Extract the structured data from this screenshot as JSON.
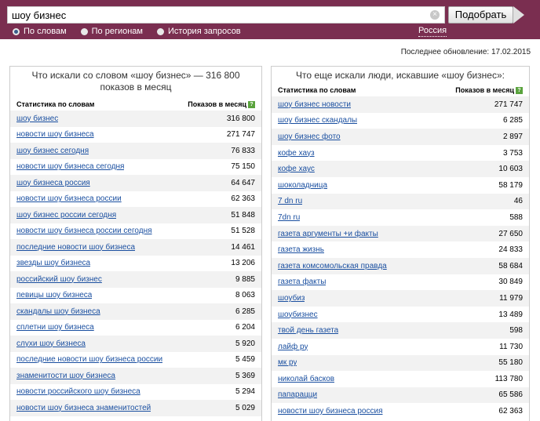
{
  "search": {
    "query": "шоу бизнес",
    "button_label": "Подобрать"
  },
  "modes": [
    {
      "label": "По словам",
      "selected": true
    },
    {
      "label": "По регионам",
      "selected": false
    },
    {
      "label": "История запросов",
      "selected": false
    }
  ],
  "region": "Россия",
  "updated": "Последнее обновление: 17.02.2015",
  "left": {
    "title": "Что искали со словом «шоу бизнес» — 316 800 показов в месяц",
    "col_words": "Статистика по словам",
    "col_count": "Показов в месяц",
    "rows": [
      {
        "phrase": "шоу бизнес",
        "count": "316 800"
      },
      {
        "phrase": "новости шоу бизнеса",
        "count": "271 747"
      },
      {
        "phrase": "шоу бизнес сегодня",
        "count": "76 833"
      },
      {
        "phrase": "новости шоу бизнеса сегодня",
        "count": "75 150"
      },
      {
        "phrase": "шоу бизнеса россия",
        "count": "64 647"
      },
      {
        "phrase": "новости шоу бизнеса россии",
        "count": "62 363"
      },
      {
        "phrase": "шоу бизнес россии сегодня",
        "count": "51 848"
      },
      {
        "phrase": "новости шоу бизнеса россии сегодня",
        "count": "51 528"
      },
      {
        "phrase": "последние новости шоу бизнеса",
        "count": "14 461"
      },
      {
        "phrase": "звезды шоу бизнеса",
        "count": "13 206"
      },
      {
        "phrase": "российский шоу бизнес",
        "count": "9 885"
      },
      {
        "phrase": "певицы шоу бизнеса",
        "count": "8 063"
      },
      {
        "phrase": "скандалы шоу бизнеса",
        "count": "6 285"
      },
      {
        "phrase": "сплетни шоу бизнеса",
        "count": "6 204"
      },
      {
        "phrase": "слухи шоу бизнеса",
        "count": "5 920"
      },
      {
        "phrase": "последние новости шоу бизнеса россии",
        "count": "5 459"
      },
      {
        "phrase": "знаменитости шоу бизнеса",
        "count": "5 369"
      },
      {
        "phrase": "новости российского шоу бизнеса",
        "count": "5 294"
      },
      {
        "phrase": "новости шоу бизнеса знаменитостей",
        "count": "5 029"
      }
    ]
  },
  "right": {
    "title": "Что еще искали люди, искавшие «шоу бизнес»:",
    "col_words": "Статистика по словам",
    "col_count": "Показов в месяц",
    "rows": [
      {
        "phrase": "шоу бизнес новости",
        "count": "271 747"
      },
      {
        "phrase": "шоу бизнес скандалы",
        "count": "6 285"
      },
      {
        "phrase": "шоу бизнес фото",
        "count": "2 897"
      },
      {
        "phrase": "кофе хауз",
        "count": "3 753"
      },
      {
        "phrase": "кофе хаус",
        "count": "10 603"
      },
      {
        "phrase": "шоколадница",
        "count": "58 179"
      },
      {
        "phrase": "7 dn ru",
        "count": "46"
      },
      {
        "phrase": "7dn ru",
        "count": "588"
      },
      {
        "phrase": "газета аргументы +и факты",
        "count": "27 650"
      },
      {
        "phrase": "газета жизнь",
        "count": "24 833"
      },
      {
        "phrase": "газета комсомольская правда",
        "count": "58 684"
      },
      {
        "phrase": "газета факты",
        "count": "30 849"
      },
      {
        "phrase": "шоубиз",
        "count": "11 979"
      },
      {
        "phrase": "шоубизнес",
        "count": "13 489"
      },
      {
        "phrase": "твой день газета",
        "count": "598"
      },
      {
        "phrase": "лайф ру",
        "count": "11 730"
      },
      {
        "phrase": "мк ру",
        "count": "55 180"
      },
      {
        "phrase": "николай басков",
        "count": "113 780"
      },
      {
        "phrase": "папарацци",
        "count": "65 586"
      },
      {
        "phrase": "новости шоу бизнеса россия",
        "count": "62 363"
      }
    ]
  },
  "colors": {
    "topbar": "#7a2e50",
    "link": "#1a4fa0",
    "stripe": "#f2f2f2"
  },
  "icons": {
    "clear": "clear-icon",
    "help": "help-icon"
  }
}
